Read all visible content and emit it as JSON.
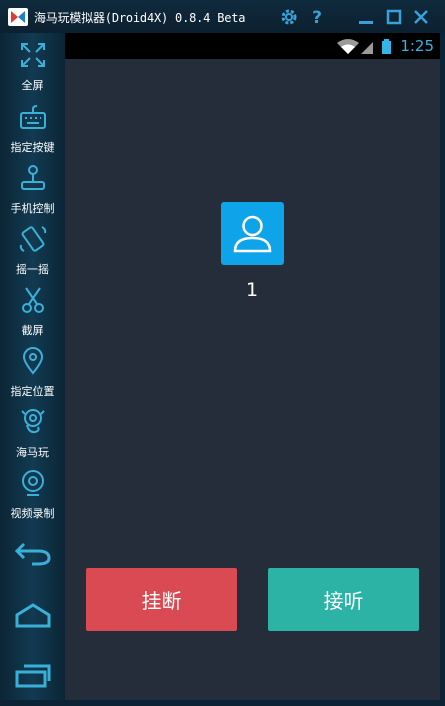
{
  "window": {
    "title": "海马玩模拟器(Droid4X) 0.8.4 Beta"
  },
  "titlebar_buttons": [
    {
      "name": "settings-icon"
    },
    {
      "name": "help-icon"
    },
    {
      "name": "minimize-icon"
    },
    {
      "name": "maximize-icon"
    },
    {
      "name": "close-icon"
    }
  ],
  "sidebar": {
    "items": [
      {
        "label": "全屏",
        "icon": "fullscreen-icon"
      },
      {
        "label": "指定按键",
        "icon": "keyboard-icon"
      },
      {
        "label": "手机控制",
        "icon": "joystick-icon"
      },
      {
        "label": "摇一摇",
        "icon": "shake-phone-icon"
      },
      {
        "label": "截屏",
        "icon": "scissors-icon"
      },
      {
        "label": "指定位置",
        "icon": "location-pin-icon"
      },
      {
        "label": "海马玩",
        "icon": "seahorse-icon"
      },
      {
        "label": "视频录制",
        "icon": "webcam-icon"
      }
    ],
    "nav": [
      "back-icon",
      "home-icon",
      "recent-apps-icon"
    ]
  },
  "statusbar": {
    "time": "1:25",
    "icons": [
      "wifi-icon",
      "signal-icon",
      "battery-icon"
    ]
  },
  "call": {
    "caller_name": "1",
    "avatar_icon": "contact-person-icon",
    "hangup_label": "挂断",
    "answer_label": "接听"
  },
  "colors": {
    "accent_blue": "#33b5e5",
    "avatar_bg": "#0ea4ea",
    "hangup": "#d94a52",
    "answer": "#2db3a6",
    "screen_bg": "#262d3a",
    "sidebar_bg": "#123a52"
  }
}
